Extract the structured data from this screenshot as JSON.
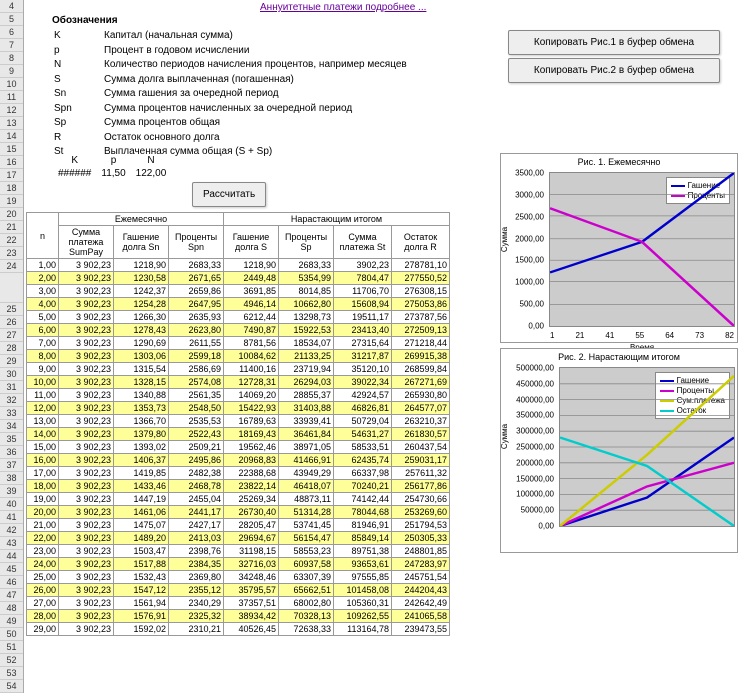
{
  "rows": [
    "4",
    "5",
    "6",
    "7",
    "8",
    "9",
    "10",
    "11",
    "12",
    "13",
    "14",
    "15",
    "16",
    "17",
    "18",
    "19",
    "20",
    "21",
    "22",
    "23",
    "24",
    "",
    "25",
    "26",
    "27",
    "28",
    "29",
    "30",
    "31",
    "32",
    "33",
    "34",
    "35",
    "36",
    "37",
    "38",
    "39",
    "40",
    "41",
    "42",
    "43",
    "44",
    "45",
    "46",
    "47",
    "48",
    "49",
    "50",
    "51",
    "52",
    "53",
    "54"
  ],
  "link": "Аннуитетные платежи подробнее ...",
  "oboz": "Обозначения",
  "defs": [
    [
      "K",
      "Капитал (начальная сумма)"
    ],
    [
      "p",
      "Процент в годовом исчислении"
    ],
    [
      "N",
      "Количество периодов начисления процентов, например месяцев"
    ],
    [
      "S",
      "Сумма долга выплаченная (погашенная)"
    ],
    [
      "Sn",
      "Сумма гашения за очередной период"
    ],
    [
      "Spn",
      "Сумма  процентов начисленных за очередной период"
    ],
    [
      "Sp",
      "Сумма процентов общая"
    ],
    [
      "R",
      "Остаток основного долга"
    ],
    [
      "St",
      "Выплаченная сумма общая (S + Sp)"
    ]
  ],
  "inputs": {
    "h": [
      "K",
      "p",
      "N"
    ],
    "v": [
      "######",
      "11,50",
      "122,00"
    ]
  },
  "btn": {
    "calc": "Рассчитать",
    "c1": "Копировать Рис.1 в буфер обмена",
    "c2": "Копировать Рис.2 в буфер обмена"
  },
  "tbl": {
    "h1": [
      "n",
      "Ежемесячно",
      "Нарастающим итогом"
    ],
    "h2": [
      "Сумма платежа SumPay",
      "Гашение долга Sn",
      "Проценты Spn",
      "Гашение долга S",
      "Проценты Sp",
      "Сумма платежа St",
      "Остаток долга R"
    ],
    "rows": [
      [
        "1,00",
        "3 902,23",
        "1218,90",
        "2683,33",
        "1218,90",
        "2683,33",
        "3902,23",
        "278781,10"
      ],
      [
        "2,00",
        "3 902,23",
        "1230,58",
        "2671,65",
        "2449,48",
        "5354,99",
        "7804,47",
        "277550,52"
      ],
      [
        "3,00",
        "3 902,23",
        "1242,37",
        "2659,86",
        "3691,85",
        "8014,85",
        "11706,70",
        "276308,15"
      ],
      [
        "4,00",
        "3 902,23",
        "1254,28",
        "2647,95",
        "4946,14",
        "10662,80",
        "15608,94",
        "275053,86"
      ],
      [
        "5,00",
        "3 902,23",
        "1266,30",
        "2635,93",
        "6212,44",
        "13298,73",
        "19511,17",
        "273787,56"
      ],
      [
        "6,00",
        "3 902,23",
        "1278,43",
        "2623,80",
        "7490,87",
        "15922,53",
        "23413,40",
        "272509,13"
      ],
      [
        "7,00",
        "3 902,23",
        "1290,69",
        "2611,55",
        "8781,56",
        "18534,07",
        "27315,64",
        "271218,44"
      ],
      [
        "8,00",
        "3 902,23",
        "1303,06",
        "2599,18",
        "10084,62",
        "21133,25",
        "31217,87",
        "269915,38"
      ],
      [
        "9,00",
        "3 902,23",
        "1315,54",
        "2586,69",
        "11400,16",
        "23719,94",
        "35120,10",
        "268599,84"
      ],
      [
        "10,00",
        "3 902,23",
        "1328,15",
        "2574,08",
        "12728,31",
        "26294,03",
        "39022,34",
        "267271,69"
      ],
      [
        "11,00",
        "3 902,23",
        "1340,88",
        "2561,35",
        "14069,20",
        "28855,37",
        "42924,57",
        "265930,80"
      ],
      [
        "12,00",
        "3 902,23",
        "1353,73",
        "2548,50",
        "15422,93",
        "31403,88",
        "46826,81",
        "264577,07"
      ],
      [
        "13,00",
        "3 902,23",
        "1366,70",
        "2535,53",
        "16789,63",
        "33939,41",
        "50729,04",
        "263210,37"
      ],
      [
        "14,00",
        "3 902,23",
        "1379,80",
        "2522,43",
        "18169,43",
        "36461,84",
        "54631,27",
        "261830,57"
      ],
      [
        "15,00",
        "3 902,23",
        "1393,02",
        "2509,21",
        "19562,46",
        "38971,05",
        "58533,51",
        "260437,54"
      ],
      [
        "16,00",
        "3 902,23",
        "1406,37",
        "2495,86",
        "20968,83",
        "41466,91",
        "62435,74",
        "259031,17"
      ],
      [
        "17,00",
        "3 902,23",
        "1419,85",
        "2482,38",
        "22388,68",
        "43949,29",
        "66337,98",
        "257611,32"
      ],
      [
        "18,00",
        "3 902,23",
        "1433,46",
        "2468,78",
        "23822,14",
        "46418,07",
        "70240,21",
        "256177,86"
      ],
      [
        "19,00",
        "3 902,23",
        "1447,19",
        "2455,04",
        "25269,34",
        "48873,11",
        "74142,44",
        "254730,66"
      ],
      [
        "20,00",
        "3 902,23",
        "1461,06",
        "2441,17",
        "26730,40",
        "51314,28",
        "78044,68",
        "253269,60"
      ],
      [
        "21,00",
        "3 902,23",
        "1475,07",
        "2427,17",
        "28205,47",
        "53741,45",
        "81946,91",
        "251794,53"
      ],
      [
        "22,00",
        "3 902,23",
        "1489,20",
        "2413,03",
        "29694,67",
        "56154,47",
        "85849,14",
        "250305,33"
      ],
      [
        "23,00",
        "3 902,23",
        "1503,47",
        "2398,76",
        "31198,15",
        "58553,23",
        "89751,38",
        "248801,85"
      ],
      [
        "24,00",
        "3 902,23",
        "1517,88",
        "2384,35",
        "32716,03",
        "60937,58",
        "93653,61",
        "247283,97"
      ],
      [
        "25,00",
        "3 902,23",
        "1532,43",
        "2369,80",
        "34248,46",
        "63307,39",
        "97555,85",
        "245751,54"
      ],
      [
        "26,00",
        "3 902,23",
        "1547,12",
        "2355,12",
        "35795,57",
        "65662,51",
        "101458,08",
        "244204,43"
      ],
      [
        "27,00",
        "3 902,23",
        "1561,94",
        "2340,29",
        "37357,51",
        "68002,80",
        "105360,31",
        "242642,49"
      ],
      [
        "28,00",
        "3 902,23",
        "1576,91",
        "2325,32",
        "38934,42",
        "70328,13",
        "109262,55",
        "241065,58"
      ],
      [
        "29,00",
        "3 902,23",
        "1592,02",
        "2310,21",
        "40526,45",
        "72638,33",
        "113164,78",
        "239473,55"
      ]
    ]
  },
  "chart_data": [
    {
      "type": "line",
      "title": "Рис. 1. Ежемесячно",
      "ylabel": "Сумма",
      "xlabel": "Время",
      "ylim": [
        0,
        3500
      ],
      "yticks": [
        "0,00",
        "500,00",
        "1000,00",
        "1500,00",
        "2000,00",
        "2500,00",
        "3000,00",
        "3500,00"
      ],
      "xticks": [
        "1",
        "21",
        "41",
        "55",
        "64",
        "73",
        "82"
      ],
      "series": [
        {
          "name": "Гашение",
          "color": "#0000cc",
          "values_sample": [
            1218.9,
            1592.02,
            3500
          ]
        },
        {
          "name": "Проценты",
          "color": "#cc00cc",
          "values_sample": [
            2683.33,
            2310.21,
            0
          ]
        }
      ]
    },
    {
      "type": "line",
      "title": "Рис. 2. Нарастающим итогом",
      "ylabel": "Сумма",
      "xlabel": "",
      "ylim": [
        0,
        500000
      ],
      "yticks": [
        "0,00",
        "50000,00",
        "100000,00",
        "150000,00",
        "200000,00",
        "250000,00",
        "300000,00",
        "350000,00",
        "400000,00",
        "450000,00",
        "500000,00"
      ],
      "series": [
        {
          "name": "Гашение",
          "color": "#0000cc"
        },
        {
          "name": "Проценты",
          "color": "#cc00cc"
        },
        {
          "name": "Сум.платежа",
          "color": "#cccc00"
        },
        {
          "name": "Остаток",
          "color": "#00cccc"
        }
      ]
    }
  ]
}
